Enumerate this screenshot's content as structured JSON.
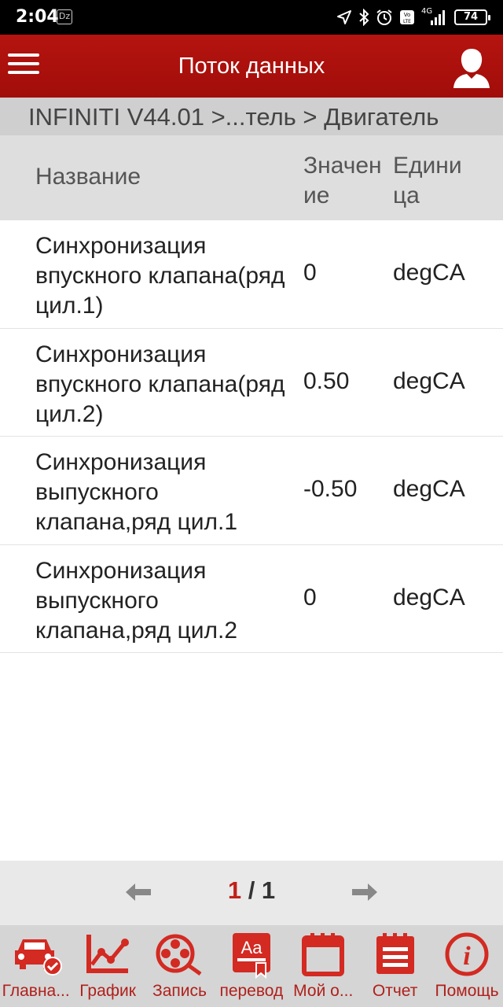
{
  "status_bar": {
    "time": "2:04",
    "notification_badge": "Dz",
    "battery": "74",
    "network": "4G",
    "icons": [
      "navigation-icon",
      "bluetooth-icon",
      "alarm-icon",
      "volte-icon",
      "signal-icon",
      "battery-icon"
    ]
  },
  "appbar": {
    "title": "Поток данных",
    "menu_icon": "menu-icon",
    "user_icon": "user-icon"
  },
  "breadcrumb": "INFINITI V44.01 >...тель > Двигатель",
  "table": {
    "headers": {
      "name": "Название",
      "value": "Значение",
      "unit": "Единица"
    },
    "rows": [
      {
        "name": "Синхронизация впускного клапана(ряд цил.1)",
        "value": "0",
        "unit": "degCA"
      },
      {
        "name": "Синхронизация впускного клапана(ряд цил.2)",
        "value": "0.50",
        "unit": "degCA"
      },
      {
        "name": "Синхронизация выпускного клапана,ряд цил.1",
        "value": "-0.50",
        "unit": "degCA"
      },
      {
        "name": "Синхронизация выпускного клапана,ряд цил.2",
        "value": "0",
        "unit": "degCA"
      }
    ]
  },
  "pager": {
    "current": "1",
    "separator": " / ",
    "total": "1"
  },
  "bottom_nav": [
    {
      "label": "Главна...",
      "icon": "car-check-icon"
    },
    {
      "label": "График",
      "icon": "chart-icon"
    },
    {
      "label": "Запись",
      "icon": "film-reel-icon"
    },
    {
      "label": "перевод",
      "icon": "dictionary-icon"
    },
    {
      "label": "Мой о...",
      "icon": "calendar-icon"
    },
    {
      "label": "Отчет",
      "icon": "report-icon"
    },
    {
      "label": "Помощь",
      "icon": "info-icon"
    }
  ],
  "colors": {
    "brand_red": "#b5140f",
    "icon_red": "#d32a22",
    "header_gray": "#dedede",
    "breadcrumb_gray": "#cfcfcf"
  }
}
